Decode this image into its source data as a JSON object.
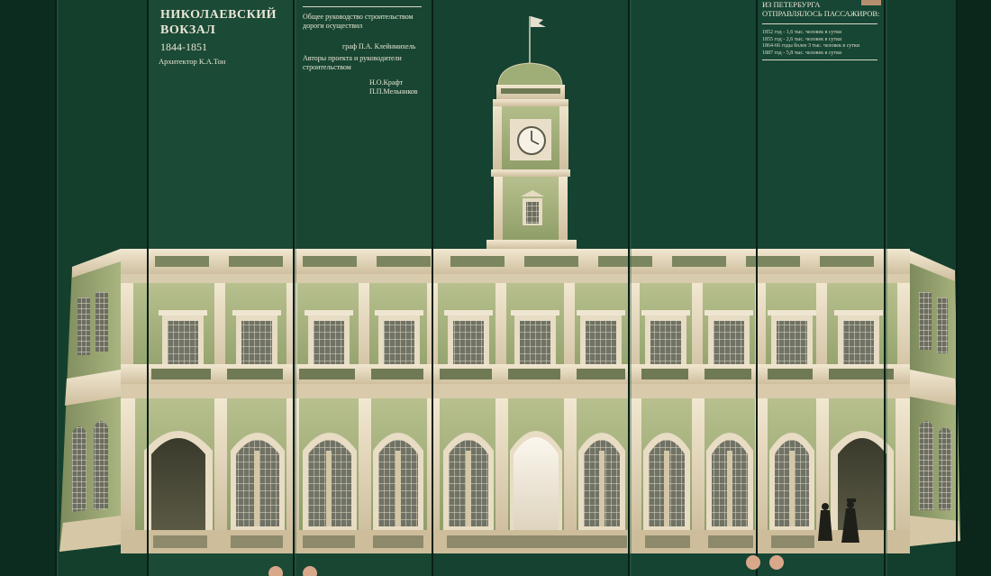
{
  "panel_left": {
    "title_line1": "НИКОЛАЕВСКИЙ",
    "title_line2": "ВОКЗАЛ",
    "years": "1844-1851",
    "architect": "Архитектор К.А.Тон"
  },
  "panel_middle": {
    "management_label": "Общее руководство строительством дороги осуществил",
    "management_name": "граф П.А. Клейнмихель",
    "authors_label": "Авторы проекта и руководители строительством",
    "author_1": "Н.О.Крафт",
    "author_2": "П.П.Мельников"
  },
  "panel_right": {
    "heading_line1": "ИЗ ПЕТЕРБУРГА",
    "heading_line2": "ОТПРАВЛЯЛОСЬ ПАССАЖИРОВ:",
    "stats": [
      "1852 год - 1,6 тыс. человек  в сутки",
      "1855 год - 2,6 тыс. человек в сутки",
      "1864-66 годы более 3 тыс. человек в сутки",
      "1887 год - 5,8 тыс. человек в сутки"
    ]
  },
  "colors": {
    "background": "#123a2a",
    "facade_light": "#e8dcc3",
    "facade_green": "#a6b47e",
    "text": "#e9e6d6"
  }
}
